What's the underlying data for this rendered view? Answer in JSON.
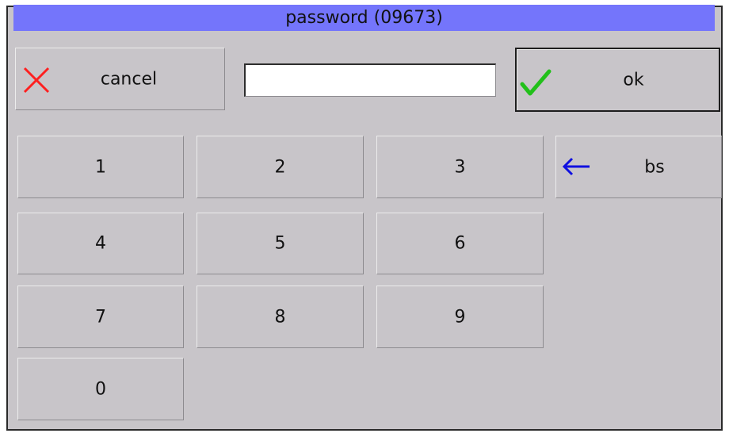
{
  "dialog": {
    "title": "password (09673)"
  },
  "actions": {
    "cancel_label": "cancel",
    "ok_label": "ok",
    "backspace_label": "bs"
  },
  "password_field": {
    "value": ""
  },
  "keypad": {
    "keys": [
      "1",
      "2",
      "3",
      "4",
      "5",
      "6",
      "7",
      "8",
      "9",
      "0"
    ]
  },
  "icons": {
    "cancel": "x-icon",
    "ok": "checkmark-icon",
    "backspace": "arrow-left-icon"
  },
  "colors": {
    "title_bar": "#7475fb",
    "background": "#c8c5c9",
    "cancel_icon": "#ff2020",
    "ok_icon": "#22c01a",
    "backspace_icon": "#1010e0"
  }
}
